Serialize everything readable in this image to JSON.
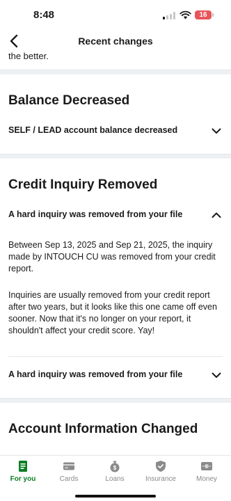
{
  "status": {
    "time": "8:48",
    "battery": "16"
  },
  "nav": {
    "title": "Recent changes"
  },
  "intro_tail": "the better.",
  "sections": [
    {
      "title": "Balance Decreased",
      "items": [
        {
          "label": "SELF / LEAD account balance decreased"
        }
      ]
    },
    {
      "title": "Credit Inquiry Removed",
      "items": [
        {
          "label": "A hard inquiry was removed from your file",
          "para1": "Between Sep 13, 2025 and Sep 21, 2025, the inquiry made by INTOUCH CU was removed from your credit report.",
          "para2": "Inquiries are usually removed from your credit report after two years, but it looks like this one came off even sooner. Now that it's no longer on your report, it shouldn't affect your credit score. Yay!"
        },
        {
          "label": "A hard inquiry was removed from your file"
        }
      ]
    },
    {
      "title": "Account Information Changed"
    }
  ],
  "tabs": [
    {
      "label": "For you",
      "icon": "for-you-icon"
    },
    {
      "label": "Cards",
      "icon": "credit-card-icon"
    },
    {
      "label": "Loans",
      "icon": "money-bag-icon"
    },
    {
      "label": "Insurance",
      "icon": "shield-icon"
    },
    {
      "label": "Money",
      "icon": "cash-icon"
    }
  ],
  "colors": {
    "accent": "#0a7f23",
    "separator": "#eef1f3",
    "battery": "#e8555a"
  }
}
